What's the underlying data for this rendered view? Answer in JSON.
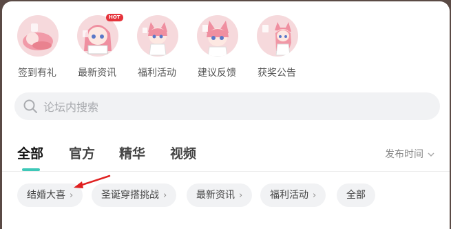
{
  "shortcuts": [
    {
      "label": "签到有礼",
      "icon": "checkin-character-icon"
    },
    {
      "label": "最新资讯",
      "icon": "news-character-icon",
      "badge": "HOT"
    },
    {
      "label": "福利活动",
      "icon": "welfare-character-icon"
    },
    {
      "label": "建议反馈",
      "icon": "feedback-character-icon"
    },
    {
      "label": "获奖公告",
      "icon": "award-character-icon"
    }
  ],
  "search": {
    "placeholder": "论坛内搜索"
  },
  "tabs": [
    {
      "label": "全部",
      "active": true
    },
    {
      "label": "官方",
      "active": false
    },
    {
      "label": "精华",
      "active": false
    },
    {
      "label": "视频",
      "active": false
    }
  ],
  "sort": {
    "label": "发布时间"
  },
  "chips": [
    {
      "label": "结婚大喜",
      "arrow": "›"
    },
    {
      "label": "圣诞穿搭挑战",
      "arrow": "›"
    },
    {
      "label": "最新资讯",
      "arrow": "›"
    },
    {
      "label": "福利活动",
      "arrow": "›"
    },
    {
      "label": "全部",
      "arrow": ""
    }
  ],
  "colors": {
    "accent": "#3ec8b8",
    "avatar_bg": "#f6d9dc",
    "hot_badge": "#e5333b",
    "annotation_arrow": "#e02020"
  }
}
